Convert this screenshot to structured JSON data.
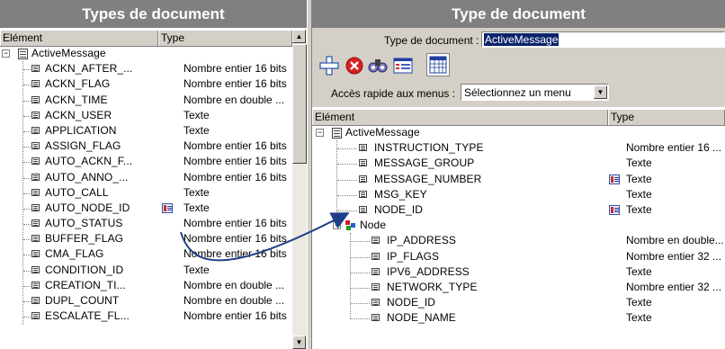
{
  "left": {
    "title": "Types de document",
    "col_element": "Elément",
    "col_type": "Type",
    "root_label": "ActiveMessage",
    "rows": [
      {
        "name": "ACKN_AFTER_...",
        "type": "Nombre entier 16 bits"
      },
      {
        "name": "ACKN_FLAG",
        "type": "Nombre entier 16 bits"
      },
      {
        "name": "ACKN_TIME",
        "type": "Nombre en double ..."
      },
      {
        "name": "ACKN_USER",
        "type": "Texte"
      },
      {
        "name": "APPLICATION",
        "type": "Texte"
      },
      {
        "name": "ASSIGN_FLAG",
        "type": "Nombre entier 16 bits"
      },
      {
        "name": "AUTO_ACKN_F...",
        "type": "Nombre entier 16 bits"
      },
      {
        "name": "AUTO_ANNO_...",
        "type": "Nombre entier 16 bits"
      },
      {
        "name": "AUTO_CALL",
        "type": "Texte"
      },
      {
        "name": "AUTO_NODE_ID",
        "type": "Texte"
      },
      {
        "name": "AUTO_STATUS",
        "type": "Nombre entier 16 bits"
      },
      {
        "name": "BUFFER_FLAG",
        "type": "Nombre entier 16 bits"
      },
      {
        "name": "CMA_FLAG",
        "type": "Nombre entier 16 bits"
      },
      {
        "name": "CONDITION_ID",
        "type": "Texte"
      },
      {
        "name": "CREATION_TI...",
        "type": "Nombre en double ..."
      },
      {
        "name": "DUPL_COUNT",
        "type": "Nombre en double ..."
      },
      {
        "name": "ESCALATE_FL...",
        "type": "Nombre entier 16 bits"
      }
    ]
  },
  "right": {
    "title": "Type de document",
    "doc_type_label": "Type de document :",
    "doc_type_value": "ActiveMessage",
    "quick_access_label": "Accès rapide aux menus :",
    "quick_access_value": "Sélectionnez un menu",
    "col_element": "Elément",
    "col_type": "Type",
    "root_label": "ActiveMessage",
    "rows": [
      {
        "name": "INSTRUCTION_TYPE",
        "type": "Nombre entier 16 ..."
      },
      {
        "name": "MESSAGE_GROUP",
        "type": "Texte"
      },
      {
        "name": "MESSAGE_NUMBER",
        "type": "Texte"
      },
      {
        "name": "MSG_KEY",
        "type": "Texte"
      },
      {
        "name": "NODE_ID",
        "type": "Texte"
      }
    ],
    "node_label": "Node",
    "node_rows": [
      {
        "name": "IP_ADDRESS",
        "type": "Nombre en double..."
      },
      {
        "name": "IP_FLAGS",
        "type": "Nombre entier 32 ..."
      },
      {
        "name": "IPV6_ADDRESS",
        "type": "Texte"
      },
      {
        "name": "NETWORK_TYPE",
        "type": "Nombre entier 32 ..."
      },
      {
        "name": "NODE_ID",
        "type": "Texte"
      },
      {
        "name": "NODE_NAME",
        "type": "Texte"
      }
    ]
  },
  "icons": {
    "add": "add-icon",
    "delete": "delete-icon",
    "find": "binoculars-icon",
    "form": "form-view-icon",
    "grid": "grid-view-icon"
  },
  "colors": {
    "title_bar": "#808080",
    "selection": "#0a246a",
    "arrow": "#1f3e8a"
  }
}
